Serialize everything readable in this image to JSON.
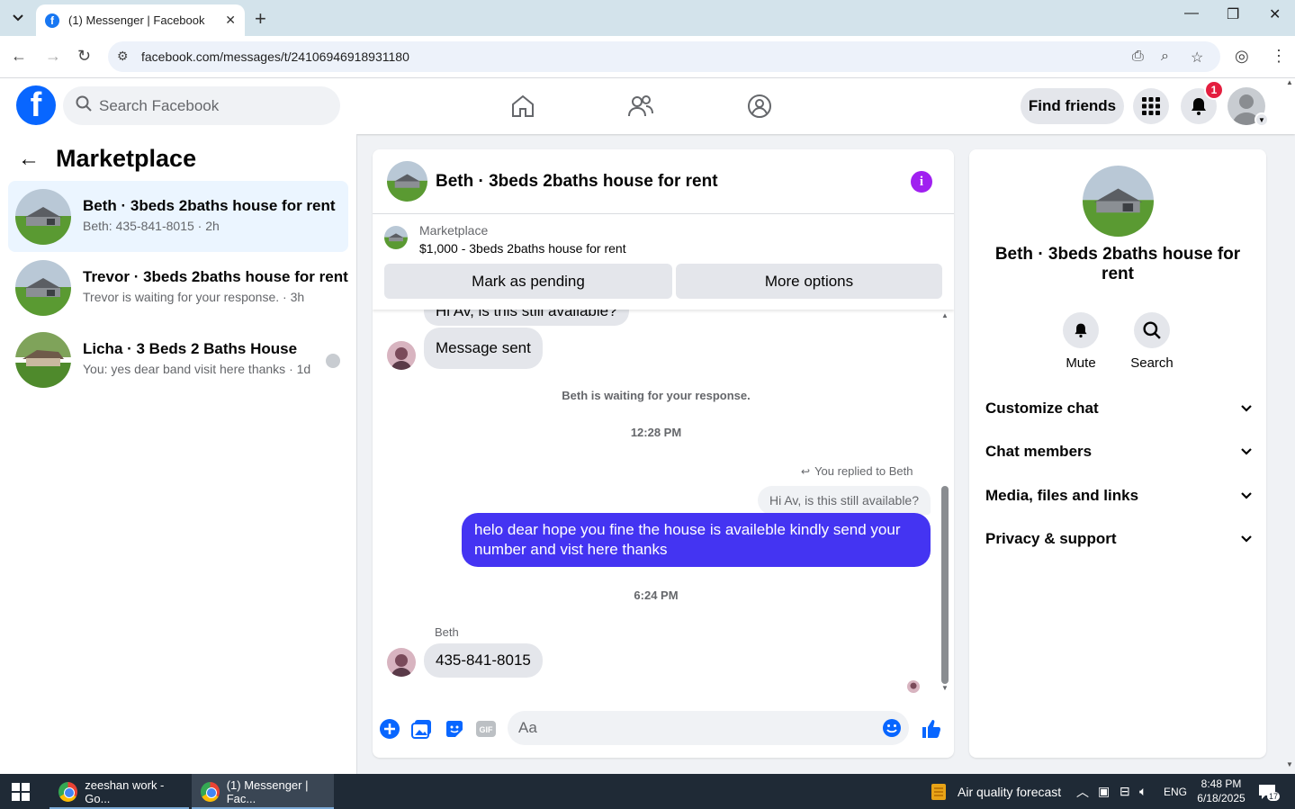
{
  "browser": {
    "tab_title": "(1) Messenger | Facebook",
    "url": "facebook.com/messages/t/24106946918931180"
  },
  "fb_header": {
    "search_placeholder": "Search Facebook",
    "find_friends": "Find friends",
    "notification_count": "1"
  },
  "sidebar": {
    "title": "Marketplace",
    "conversations": [
      {
        "title": "Beth · 3beds 2baths house for rent",
        "subtitle": "Beth: 435-841-8015 · 2h",
        "active": true
      },
      {
        "title": "Trevor · 3beds 2baths house for rent",
        "subtitle": "Trevor is waiting for your response. · 3h",
        "active": false
      },
      {
        "title": "Licha · 3 Beds 2 Baths House",
        "subtitle": "You: yes dear band visit here thanks · 1d",
        "active": false
      }
    ]
  },
  "chat": {
    "title": "Beth · 3beds 2baths house for rent",
    "listing": {
      "source": "Marketplace",
      "title": "$1,000 - 3beds 2baths house for rent",
      "mark_pending": "Mark as pending",
      "more_options": "More options"
    },
    "messages": {
      "cut_off_top": "Hi Av, is this still available?",
      "message_sent": "Message sent",
      "waiting_note": "Beth is waiting for your response.",
      "time1": "12:28 PM",
      "replied_note": "You replied to Beth",
      "reply_quote": "Hi Av, is this still available?",
      "my_message": "helo dear hope you fine the house is availeble kindly send your number and vist here thanks",
      "time2": "6:24 PM",
      "sender_name": "Beth",
      "beth_message": "435-841-8015"
    },
    "composer_placeholder": "Aa"
  },
  "info_panel": {
    "title": "Beth · 3beds 2baths house for rent",
    "actions": [
      "Mute",
      "Search"
    ],
    "sections": [
      "Customize chat",
      "Chat members",
      "Media, files and links",
      "Privacy & support"
    ]
  },
  "taskbar": {
    "items": [
      "zeeshan work - Go...",
      "(1) Messenger | Fac..."
    ],
    "weather": "Air quality forecast",
    "lang": "ENG",
    "time": "8:48 PM",
    "date": "6/18/2025",
    "notif_count": "17"
  },
  "colors": {
    "fb_blue": "#0866ff",
    "my_bubble": "#4434f2",
    "info_purple": "#a020f0",
    "badge_red": "#e41e3f"
  }
}
